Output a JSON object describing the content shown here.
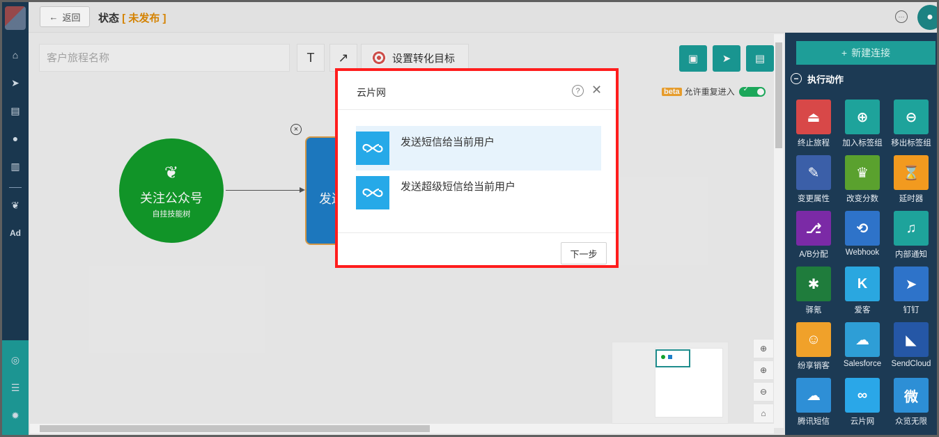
{
  "header": {
    "back_label": "返回",
    "title": "状态",
    "status": "[ 未发布 ]"
  },
  "canvas": {
    "journey_name_placeholder": "客户旅程名称",
    "text_tool": "T",
    "arrow_tool": "↗",
    "goal_label": "设置转化目标",
    "beta": "beta",
    "repeat_entry_label": "允许重复进入",
    "repeat_entry_enabled": true,
    "nodes": {
      "follow": {
        "title": "关注公众号",
        "subtitle": "自挂技能树"
      },
      "send": {
        "label": "发送"
      }
    }
  },
  "sidebar": {
    "items": [
      "home-icon",
      "send-icon",
      "layout-icon",
      "user-icon",
      "chart-icon",
      "wechat-icon",
      "ad-label"
    ],
    "ad_label": "Ad"
  },
  "right_panel": {
    "new_connection": "新建连接",
    "section_title": "执行动作",
    "actions": [
      {
        "label": "终止旅程",
        "icon": "eject-icon",
        "color": "#d84848",
        "glyph": "⏏"
      },
      {
        "label": "加入标签组",
        "icon": "user-add-icon",
        "color": "#1ea39b",
        "glyph": "⊕"
      },
      {
        "label": "移出标签组",
        "icon": "user-remove-icon",
        "color": "#1ea39b",
        "glyph": "⊖"
      },
      {
        "label": "变更属性",
        "icon": "edit-icon",
        "color": "#3b5fa8",
        "glyph": "✎"
      },
      {
        "label": "改变分数",
        "icon": "trophy-icon",
        "color": "#5aa12e",
        "glyph": "♛"
      },
      {
        "label": "延时器",
        "icon": "hourglass-icon",
        "color": "#f29a1f",
        "glyph": "⌛"
      },
      {
        "label": "A/B分配",
        "icon": "ab-split-icon",
        "color": "#7b2aa6",
        "glyph": "⎇"
      },
      {
        "label": "Webhook",
        "icon": "webhook-icon",
        "color": "#2e73c9",
        "glyph": "⟲"
      },
      {
        "label": "内部通知",
        "icon": "bell-icon",
        "color": "#1ea39b",
        "glyph": "♫"
      },
      {
        "label": "驿氪",
        "icon": "spider-icon",
        "color": "#1f7c3c",
        "glyph": "✱"
      },
      {
        "label": "爱客",
        "icon": "aike-icon",
        "color": "#2aa7e0",
        "glyph": "K"
      },
      {
        "label": "钉钉",
        "icon": "dingtalk-icon",
        "color": "#2e73c9",
        "glyph": "➤"
      },
      {
        "label": "纷享销客",
        "icon": "fxiaoke-icon",
        "color": "#f0a12a",
        "glyph": "☺"
      },
      {
        "label": "Salesforce",
        "icon": "salesforce-icon",
        "color": "#2e9ed6",
        "glyph": "☁"
      },
      {
        "label": "SendCloud",
        "icon": "sendcloud-icon",
        "color": "#2557a6",
        "glyph": "◣"
      },
      {
        "label": "腾讯短信",
        "icon": "tencent-sms-icon",
        "color": "#2e8fd6",
        "glyph": "☁"
      },
      {
        "label": "云片网",
        "icon": "yunpian-icon",
        "color": "#2aa7e8",
        "glyph": "∞"
      },
      {
        "label": "众览无限",
        "icon": "zhonglan-icon",
        "color": "#2d8fd6",
        "glyph": "微"
      }
    ]
  },
  "modal": {
    "title": "云片网",
    "options": [
      {
        "label": "发送短信给当前用户",
        "selected": true
      },
      {
        "label": "发送超级短信给当前用户",
        "selected": false
      }
    ],
    "next_label": "下一步"
  }
}
